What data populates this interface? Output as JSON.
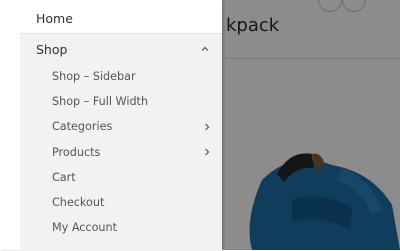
{
  "page": {
    "title_fragment": "kpack"
  },
  "drawer": {
    "home_label": "Home",
    "shop": {
      "label": "Shop",
      "items": [
        {
          "label": "Shop – Sidebar",
          "has_submenu": false
        },
        {
          "label": "Shop – Full Width",
          "has_submenu": false
        },
        {
          "label": "Categories",
          "has_submenu": true
        },
        {
          "label": "Products",
          "has_submenu": true
        },
        {
          "label": "Cart",
          "has_submenu": false
        },
        {
          "label": "Checkout",
          "has_submenu": false
        },
        {
          "label": "My Account",
          "has_submenu": false
        }
      ]
    }
  },
  "icons": {
    "collapse": "chevron-up-icon",
    "expand": "chevron-right-icon"
  },
  "colors": {
    "overlay": "#00000073",
    "shop_bg": "#f2f2f2",
    "product_blue": "#1f6fa8"
  }
}
